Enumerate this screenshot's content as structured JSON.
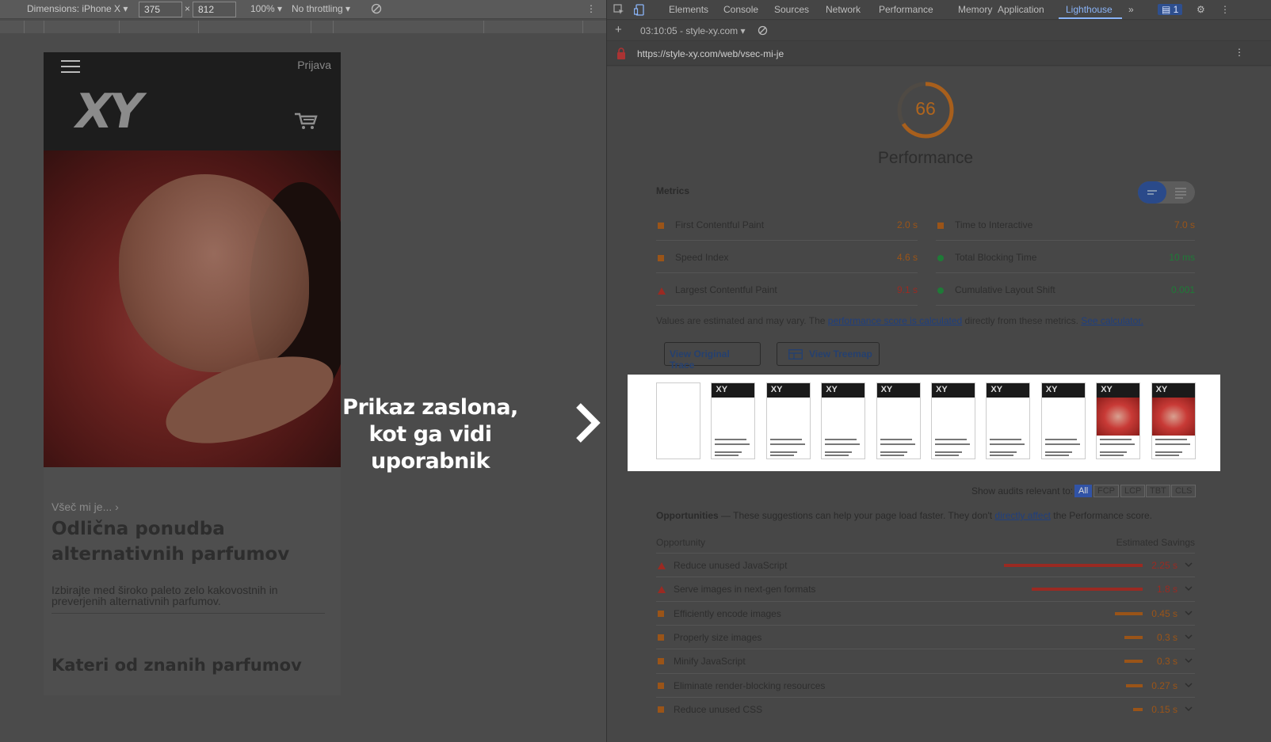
{
  "device_toolbar": {
    "dimensions_label": "Dimensions: iPhone X",
    "width": "375",
    "times": "×",
    "height": "812",
    "zoom": "100%",
    "throttling": "No throttling"
  },
  "phone": {
    "login": "Prijava",
    "logo": "XY",
    "breadcrumb": "Všeč mi je...",
    "title": "Odlična ponudba alternativnih parfumov",
    "description": "Izbirajte med široko paleto zelo kakovostnih in preverjenih alternativnih parfumov.",
    "subtitle": "Kateri od znanih parfumov"
  },
  "caption": {
    "line1": "Prikaz zaslona,",
    "line2": "kot ga vidi uporabnik"
  },
  "devtools": {
    "tabs": [
      "Elements",
      "Console",
      "Sources",
      "Network",
      "Performance",
      "Memory",
      "Application",
      "Lighthouse"
    ],
    "active_tab": "Lighthouse",
    "issues_count": "1",
    "report_selector": "03:10:05 - style-xy.com",
    "url": "https://style-xy.com/web/vsec-mi-je"
  },
  "lighthouse": {
    "score": "66",
    "score_value": 0.66,
    "category": "Performance",
    "metrics_heading": "Metrics",
    "metrics_left": [
      {
        "label": "First Contentful Paint",
        "value": "2.0 s",
        "status": "average"
      },
      {
        "label": "Speed Index",
        "value": "4.6 s",
        "status": "average"
      },
      {
        "label": "Largest Contentful Paint",
        "value": "9.1 s",
        "status": "fail"
      }
    ],
    "metrics_right": [
      {
        "label": "Time to Interactive",
        "value": "7.0 s",
        "status": "average"
      },
      {
        "label": "Total Blocking Time",
        "value": "10 ms",
        "status": "pass"
      },
      {
        "label": "Cumulative Layout Shift",
        "value": "0.001",
        "status": "pass"
      }
    ],
    "note": {
      "before": "Values are estimated and may vary. The ",
      "link1": "performance score is calculated",
      "middle": " directly from these metrics. ",
      "link2": "See calculator."
    },
    "buttons": {
      "trace": "View Original Trace",
      "treemap": "View Treemap"
    },
    "filmstrip_logo": "XY",
    "show_audits_label": "Show audits relevant to:",
    "audit_filters": [
      "All",
      "FCP",
      "LCP",
      "TBT",
      "CLS"
    ],
    "opportunities": {
      "title": "Opportunities",
      "dash": " — These suggestions can help your page load faster. They don't ",
      "link": "directly affect",
      "after": " the Performance score.",
      "col_opportunity": "Opportunity",
      "col_savings": "Estimated Savings",
      "items": [
        {
          "label": "Reduce unused JavaScript",
          "value": "2.25 s",
          "savings": 2.25,
          "status": "fail"
        },
        {
          "label": "Serve images in next-gen formats",
          "value": "1.8 s",
          "savings": 1.8,
          "status": "fail"
        },
        {
          "label": "Efficiently encode images",
          "value": "0.45 s",
          "savings": 0.45,
          "status": "average"
        },
        {
          "label": "Properly size images",
          "value": "0.3 s",
          "savings": 0.3,
          "status": "average"
        },
        {
          "label": "Minify JavaScript",
          "value": "0.3 s",
          "savings": 0.3,
          "status": "average"
        },
        {
          "label": "Eliminate render-blocking resources",
          "value": "0.27 s",
          "savings": 0.27,
          "status": "average"
        },
        {
          "label": "Reduce unused CSS",
          "value": "0.15 s",
          "savings": 0.15,
          "status": "average"
        }
      ]
    }
  },
  "colors": {
    "fail": "#9a2a22",
    "average": "#9a5418",
    "pass": "#1f7a37",
    "link": "#8ab4f8",
    "score": "#b0651d"
  }
}
